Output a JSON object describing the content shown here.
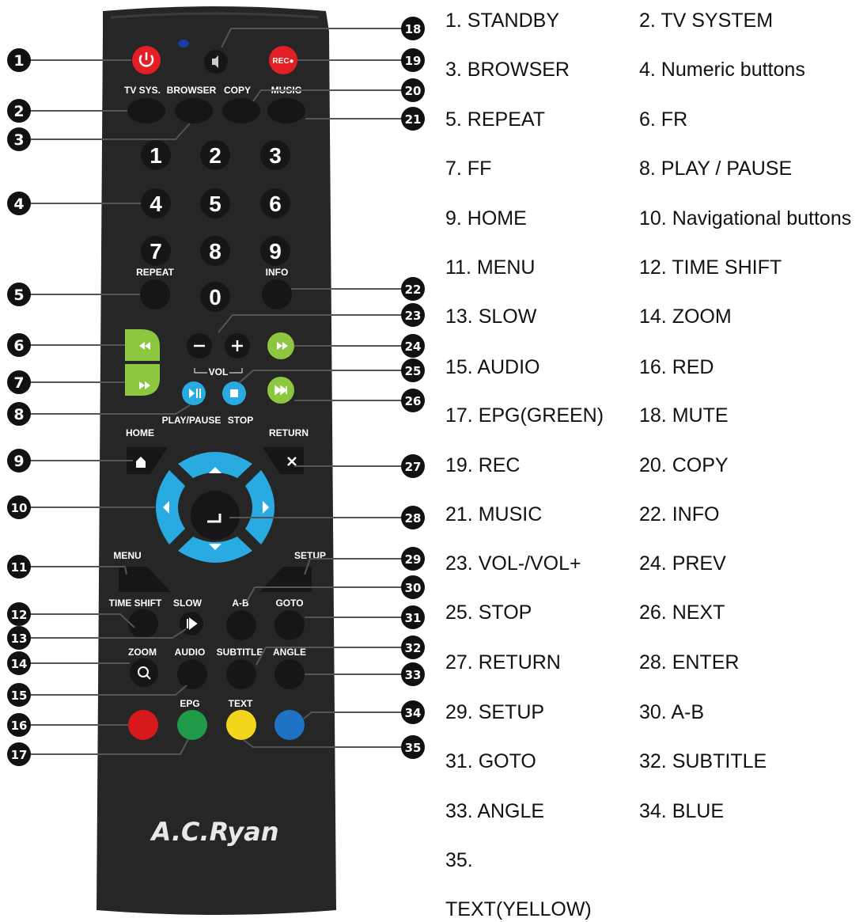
{
  "remote": {
    "brand": "A.C.Ryan",
    "top_labels": {
      "tv_sys": "TV SYS.",
      "browser": "BROWSER",
      "copy": "COPY",
      "music": "MUSIC",
      "rec": "REC●"
    },
    "numerals": [
      "1",
      "2",
      "3",
      "4",
      "5",
      "6",
      "7",
      "8",
      "9",
      "0"
    ],
    "mid_labels": {
      "repeat": "REPEAT",
      "info": "INFO",
      "vol": "VOL",
      "play_pause": "PLAY/PAUSE",
      "stop": "STOP",
      "home": "HOME",
      "return": "RETURN"
    },
    "low_labels": {
      "menu": "MENU",
      "setup": "SETUP",
      "time_shift": "TIME SHIFT",
      "slow": "SLOW",
      "a_b": "A-B",
      "goto": "GOTO",
      "zoom": "ZOOM",
      "audio": "AUDIO",
      "subtitle": "SUBTITLE",
      "angle": "ANGLE",
      "epg": "EPG",
      "text": "TEXT"
    },
    "button_colors": {
      "body": "#262626",
      "key": "#161616",
      "green": "#8dc63f",
      "blue": "#29abe2",
      "red": "#d7191b",
      "epg_green": "#1e9a49",
      "yellow": "#f2d51c",
      "colour_blue": "#1e73c4",
      "power": "#e31e24"
    },
    "markers": [
      "1",
      "2",
      "3",
      "4",
      "5",
      "6",
      "7",
      "8",
      "9",
      "10",
      "11",
      "12",
      "13",
      "14",
      "15",
      "16",
      "17",
      "18",
      "19",
      "20",
      "21",
      "22",
      "23",
      "24",
      "25",
      "26",
      "27",
      "28",
      "29",
      "30",
      "31",
      "32",
      "33",
      "34",
      "35"
    ]
  },
  "key_list": [
    "1. STANDBY",
    "2. TV SYSTEM",
    "3. BROWSER",
    "4. Numeric buttons",
    "5. REPEAT",
    "6. FR",
    "7. FF",
    "8. PLAY / PAUSE",
    "9. HOME",
    "10. Navigational buttons",
    "11. MENU",
    "12. TIME SHIFT",
    "13. SLOW",
    "14. ZOOM",
    "15. AUDIO",
    "16. RED",
    "17. EPG(GREEN)",
    "18. MUTE",
    "19. REC",
    "20. COPY",
    "21. MUSIC",
    "22. INFO",
    "23. VOL-/VOL+",
    "24. PREV",
    "25. STOP",
    "26. NEXT",
    "27. RETURN",
    "28. ENTER",
    "29. SETUP",
    "30. A-B",
    "31. GOTO",
    "32. SUBTITLE",
    "33. ANGLE",
    "34. BLUE",
    "35.",
    "TEXT(YELLOW)"
  ]
}
